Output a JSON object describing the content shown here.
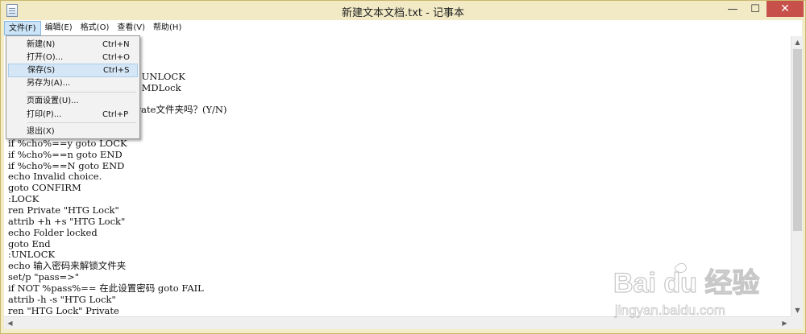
{
  "window": {
    "title": "新建文本文档.txt - 记事本",
    "minimize_glyph": "—",
    "maximize_glyph": "☐",
    "close_glyph": "✕"
  },
  "menubar": [
    {
      "label": "文件(F)"
    },
    {
      "label": "编辑(E)"
    },
    {
      "label": "格式(O)"
    },
    {
      "label": "查看(V)"
    },
    {
      "label": "帮助(H)"
    }
  ],
  "file_menu": [
    {
      "label": "新建(N)",
      "shortcut": "Ctrl+N"
    },
    {
      "label": "打开(O)...",
      "shortcut": "Ctrl+O"
    },
    {
      "label": "保存(S)",
      "shortcut": "Ctrl+S"
    },
    {
      "label": "另存为(A)...",
      "shortcut": ""
    },
    {
      "label": "页面设置(U)...",
      "shortcut": ""
    },
    {
      "label": "打印(P)...",
      "shortcut": "Ctrl+P"
    },
    {
      "label": "退出(X)",
      "shortcut": ""
    }
  ],
  "editor": {
    "lines": [
      {
        "text": "o UNLOCK"
      },
      {
        "text": "o MDLock"
      },
      {
        "text": "ivate文件夹吗？(Y/N)"
      },
      {
        "text": "if %cho%==y goto LOCK"
      },
      {
        "text": "if %cho%==n goto END"
      },
      {
        "text": "if %cho%==N goto END"
      },
      {
        "text": "echo Invalid choice."
      },
      {
        "text": "goto CONFIRM"
      },
      {
        "text": ":LOCK"
      },
      {
        "text": "ren Private \"HTG Lock\""
      },
      {
        "text": "attrib +h +s \"HTG Lock\""
      },
      {
        "text": "echo Folder locked"
      },
      {
        "text": "goto End"
      },
      {
        "text": ":UNLOCK"
      },
      {
        "text": "echo 输入密码来解锁文件夹"
      },
      {
        "text": "set/p \"pass=>\""
      },
      {
        "text": "if NOT %pass%== 在此设置密码 goto FAIL"
      },
      {
        "text": "attrib -h -s \"HTG Lock\""
      },
      {
        "text": "ren \"HTG Lock\" Private"
      }
    ]
  },
  "watermark": {
    "brand": "Bai du 经验",
    "url": "jingyan.baidu.com"
  }
}
